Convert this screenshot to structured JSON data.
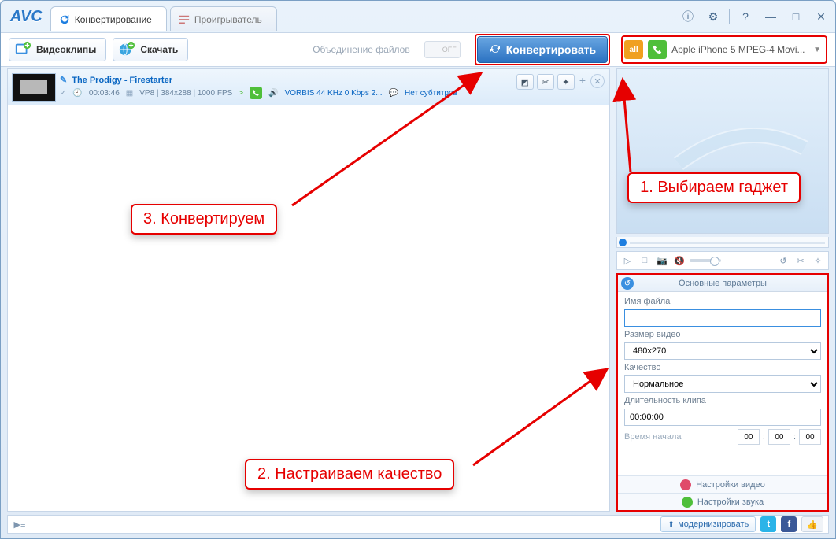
{
  "app": {
    "logo": "AVC"
  },
  "tabs": {
    "convert": "Конвертирование",
    "player": "Проигрыватель"
  },
  "titlebar_icons": {
    "info": "ⓘ",
    "gear": "⚙",
    "help": "?",
    "min": "—",
    "max": "□",
    "close": "✕"
  },
  "toolbar": {
    "add_clips": "Видеоклипы",
    "download": "Скачать",
    "merge": "Объединение файлов",
    "off": "OFF",
    "convert": "Конвертировать",
    "profile_all": "all",
    "profile_name": "Apple iPhone 5 MPEG-4 Movi..."
  },
  "clip": {
    "title": "The Prodigy - Firestarter",
    "duration": "00:03:46",
    "codec": "VP8 | 384x288 | 1000 FPS",
    "audio": "VORBIS 44 KHz 0 Kbps 2...",
    "subs": "Нет субтитров",
    "arrow": ">"
  },
  "params": {
    "header": "Основные параметры",
    "filename_label": "Имя файла",
    "filename_value": "",
    "size_label": "Размер видео",
    "size_value": "480x270",
    "quality_label": "Качество",
    "quality_value": "Нормальное",
    "duration_label": "Длительность клипа",
    "duration_value": "00:00:00",
    "start_label": "Время начала",
    "t_h": "00",
    "t_m": "00",
    "t_s": "00",
    "video_settings": "Настройки видео",
    "audio_settings": "Настройки звука"
  },
  "callouts": {
    "c1": "1. Выбираем гаджет",
    "c2": "2. Настраиваем качество",
    "c3": "3. Конвертируем"
  },
  "status": {
    "upgrade": "модернизировать"
  }
}
